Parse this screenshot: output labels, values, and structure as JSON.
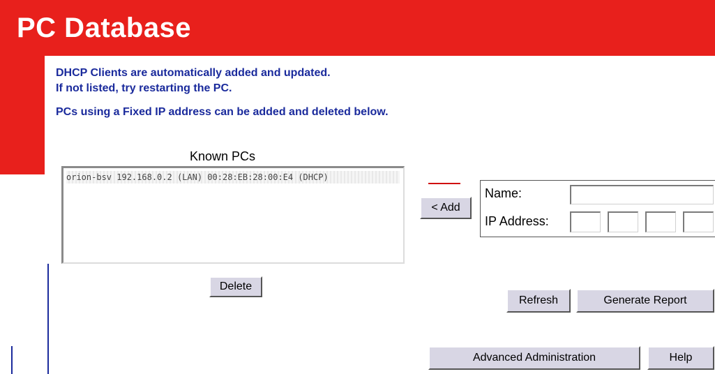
{
  "header": {
    "title": "PC Database"
  },
  "info": {
    "line1": "DHCP Clients are automatically added and updated.",
    "line2": "If not listed, try restarting the PC.",
    "line3": "PCs using a Fixed IP address can be added and deleted below."
  },
  "known_pcs": {
    "label": "Known PCs",
    "items": [
      "orion-bsv 192.168.0.2 (LAN) 00:28:EB:28:00:E4 (DHCP)"
    ]
  },
  "buttons": {
    "add": "< Add",
    "delete": "Delete",
    "refresh": "Refresh",
    "generate_report": "Generate Report",
    "advanced_administration": "Advanced Administration",
    "help": "Help"
  },
  "form": {
    "name_label": "Name:",
    "name_value": "",
    "ip_label": "IP Address:",
    "ip_octets": [
      "",
      "",
      "",
      ""
    ]
  },
  "colors": {
    "banner": "#e8201c",
    "info_text": "#1a2a9c",
    "button": "#d8d6e4"
  }
}
